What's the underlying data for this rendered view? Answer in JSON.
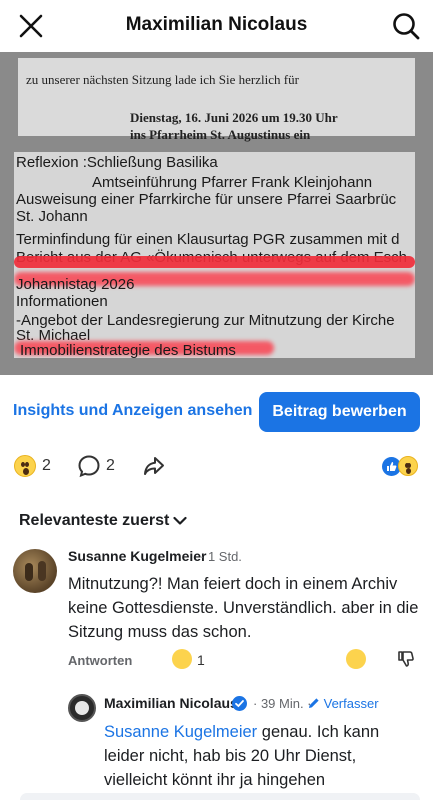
{
  "header": {
    "title": "Maximilian Nicolaus"
  },
  "photo": {
    "invite_line": "zu unserer nächsten Sitzung lade ich Sie herzlich für",
    "date_line": "Dienstag, 16. Juni 2026 um 19.30 Uhr",
    "place_line": "ins Pfarrheim St. Augustinus ein",
    "agenda": [
      "Reflexion :Schließung Basilika",
      "Amtseinführung Pfarrer Frank Kleinjohann",
      "Ausweisung einer Pfarrkirche für unsere Pfarrei Saarbrüc",
      "St. Johann",
      "Terminfindung für einen Klausurtag PGR zusammen mit d",
      "Bericht aus der AG «Ökumenisch unterwegs auf dem Esch",
      "Johannistag 2026",
      "Informationen",
      "-Angebot der Landesregierung zur Mitnutzung der Kirche",
      "St. Michael",
      "Immobilienstrategie des Bistums"
    ],
    "highlight_color": "#f02d3a"
  },
  "actions": {
    "insights_label": "Insights und Anzeigen ansehen",
    "promote_label": "Beitrag bewerben",
    "accent": "#1b74e4"
  },
  "reactions": {
    "wow_count": "2",
    "comment_count": "2",
    "summary_icons": [
      "like-icon",
      "wow-icon"
    ]
  },
  "sort": {
    "label": "Relevanteste zuerst"
  },
  "comments": [
    {
      "author": "Susanne Kugelmeier",
      "time": "· 1 Std.",
      "text": "Mitnutzung?! Man feiert doch in einem Archiv keine Gottesdienste. Unverständlich. aber in die Sitzung muss  das schon.",
      "reply_label": "Antworten",
      "reaction_count": "1"
    }
  ],
  "reply": {
    "author": "Maximilian Nicolaus",
    "time": "· 39 Min. ·",
    "badge": "Verfasser",
    "mention": "Susanne Kugelmeier",
    "text": " genau. Ich kann leider nicht, hab bis 20 Uhr Dienst, vielleicht könnt ihr ja hingehen"
  }
}
